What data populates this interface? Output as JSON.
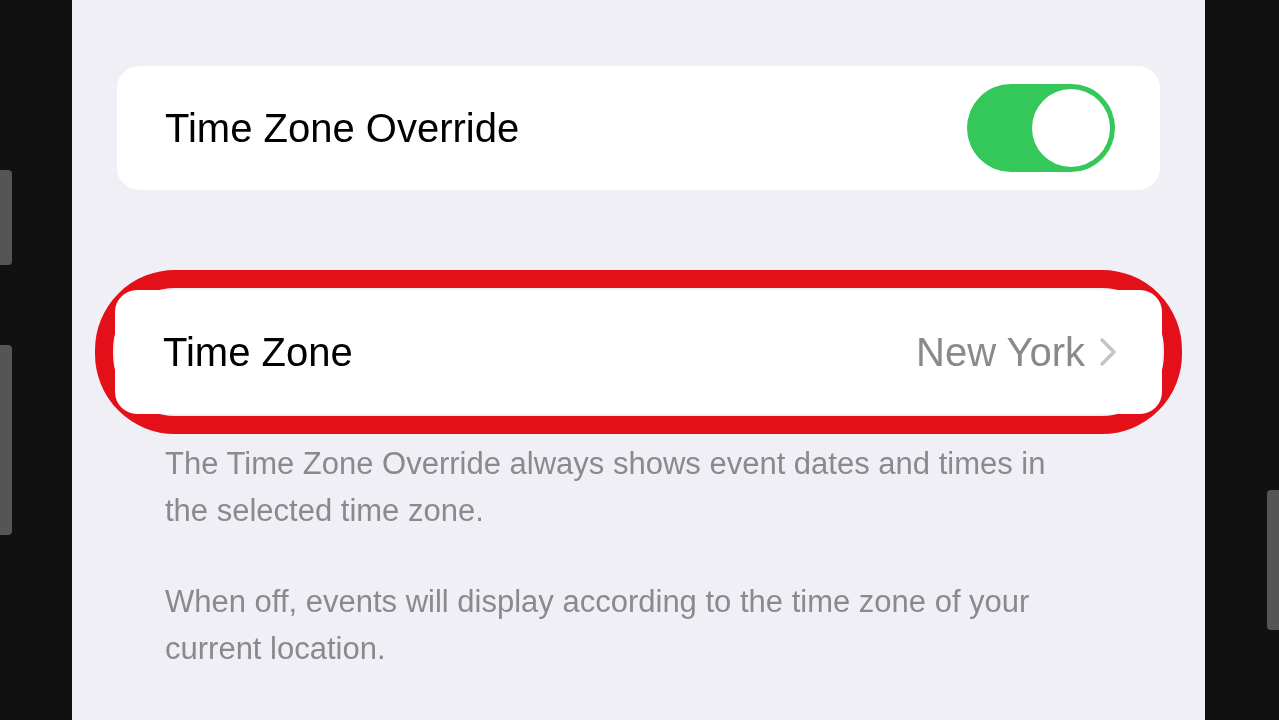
{
  "rows": [
    {
      "kind": "toggle",
      "label": "Time Zone Override",
      "on": true
    },
    {
      "kind": "link",
      "label": "Time Zone",
      "value": "New York",
      "highlighted": true
    }
  ],
  "footer": [
    "The Time Zone Override always shows event dates and times in the selected time zone.",
    "When off, events will display according to the time zone of your current location."
  ]
}
